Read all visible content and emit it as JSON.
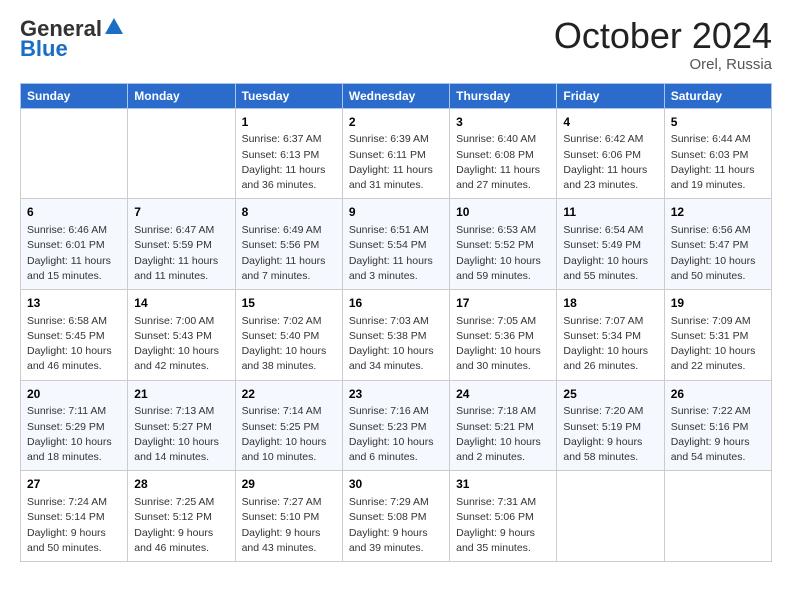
{
  "header": {
    "logo_general": "General",
    "logo_blue": "Blue",
    "month_title": "October 2024",
    "location": "Orel, Russia"
  },
  "days_of_week": [
    "Sunday",
    "Monday",
    "Tuesday",
    "Wednesday",
    "Thursday",
    "Friday",
    "Saturday"
  ],
  "weeks": [
    [
      {
        "day": "",
        "info": ""
      },
      {
        "day": "",
        "info": ""
      },
      {
        "day": "1",
        "info": "Sunrise: 6:37 AM\nSunset: 6:13 PM\nDaylight: 11 hours and 36 minutes."
      },
      {
        "day": "2",
        "info": "Sunrise: 6:39 AM\nSunset: 6:11 PM\nDaylight: 11 hours and 31 minutes."
      },
      {
        "day": "3",
        "info": "Sunrise: 6:40 AM\nSunset: 6:08 PM\nDaylight: 11 hours and 27 minutes."
      },
      {
        "day": "4",
        "info": "Sunrise: 6:42 AM\nSunset: 6:06 PM\nDaylight: 11 hours and 23 minutes."
      },
      {
        "day": "5",
        "info": "Sunrise: 6:44 AM\nSunset: 6:03 PM\nDaylight: 11 hours and 19 minutes."
      }
    ],
    [
      {
        "day": "6",
        "info": "Sunrise: 6:46 AM\nSunset: 6:01 PM\nDaylight: 11 hours and 15 minutes."
      },
      {
        "day": "7",
        "info": "Sunrise: 6:47 AM\nSunset: 5:59 PM\nDaylight: 11 hours and 11 minutes."
      },
      {
        "day": "8",
        "info": "Sunrise: 6:49 AM\nSunset: 5:56 PM\nDaylight: 11 hours and 7 minutes."
      },
      {
        "day": "9",
        "info": "Sunrise: 6:51 AM\nSunset: 5:54 PM\nDaylight: 11 hours and 3 minutes."
      },
      {
        "day": "10",
        "info": "Sunrise: 6:53 AM\nSunset: 5:52 PM\nDaylight: 10 hours and 59 minutes."
      },
      {
        "day": "11",
        "info": "Sunrise: 6:54 AM\nSunset: 5:49 PM\nDaylight: 10 hours and 55 minutes."
      },
      {
        "day": "12",
        "info": "Sunrise: 6:56 AM\nSunset: 5:47 PM\nDaylight: 10 hours and 50 minutes."
      }
    ],
    [
      {
        "day": "13",
        "info": "Sunrise: 6:58 AM\nSunset: 5:45 PM\nDaylight: 10 hours and 46 minutes."
      },
      {
        "day": "14",
        "info": "Sunrise: 7:00 AM\nSunset: 5:43 PM\nDaylight: 10 hours and 42 minutes."
      },
      {
        "day": "15",
        "info": "Sunrise: 7:02 AM\nSunset: 5:40 PM\nDaylight: 10 hours and 38 minutes."
      },
      {
        "day": "16",
        "info": "Sunrise: 7:03 AM\nSunset: 5:38 PM\nDaylight: 10 hours and 34 minutes."
      },
      {
        "day": "17",
        "info": "Sunrise: 7:05 AM\nSunset: 5:36 PM\nDaylight: 10 hours and 30 minutes."
      },
      {
        "day": "18",
        "info": "Sunrise: 7:07 AM\nSunset: 5:34 PM\nDaylight: 10 hours and 26 minutes."
      },
      {
        "day": "19",
        "info": "Sunrise: 7:09 AM\nSunset: 5:31 PM\nDaylight: 10 hours and 22 minutes."
      }
    ],
    [
      {
        "day": "20",
        "info": "Sunrise: 7:11 AM\nSunset: 5:29 PM\nDaylight: 10 hours and 18 minutes."
      },
      {
        "day": "21",
        "info": "Sunrise: 7:13 AM\nSunset: 5:27 PM\nDaylight: 10 hours and 14 minutes."
      },
      {
        "day": "22",
        "info": "Sunrise: 7:14 AM\nSunset: 5:25 PM\nDaylight: 10 hours and 10 minutes."
      },
      {
        "day": "23",
        "info": "Sunrise: 7:16 AM\nSunset: 5:23 PM\nDaylight: 10 hours and 6 minutes."
      },
      {
        "day": "24",
        "info": "Sunrise: 7:18 AM\nSunset: 5:21 PM\nDaylight: 10 hours and 2 minutes."
      },
      {
        "day": "25",
        "info": "Sunrise: 7:20 AM\nSunset: 5:19 PM\nDaylight: 9 hours and 58 minutes."
      },
      {
        "day": "26",
        "info": "Sunrise: 7:22 AM\nSunset: 5:16 PM\nDaylight: 9 hours and 54 minutes."
      }
    ],
    [
      {
        "day": "27",
        "info": "Sunrise: 7:24 AM\nSunset: 5:14 PM\nDaylight: 9 hours and 50 minutes."
      },
      {
        "day": "28",
        "info": "Sunrise: 7:25 AM\nSunset: 5:12 PM\nDaylight: 9 hours and 46 minutes."
      },
      {
        "day": "29",
        "info": "Sunrise: 7:27 AM\nSunset: 5:10 PM\nDaylight: 9 hours and 43 minutes."
      },
      {
        "day": "30",
        "info": "Sunrise: 7:29 AM\nSunset: 5:08 PM\nDaylight: 9 hours and 39 minutes."
      },
      {
        "day": "31",
        "info": "Sunrise: 7:31 AM\nSunset: 5:06 PM\nDaylight: 9 hours and 35 minutes."
      },
      {
        "day": "",
        "info": ""
      },
      {
        "day": "",
        "info": ""
      }
    ]
  ]
}
